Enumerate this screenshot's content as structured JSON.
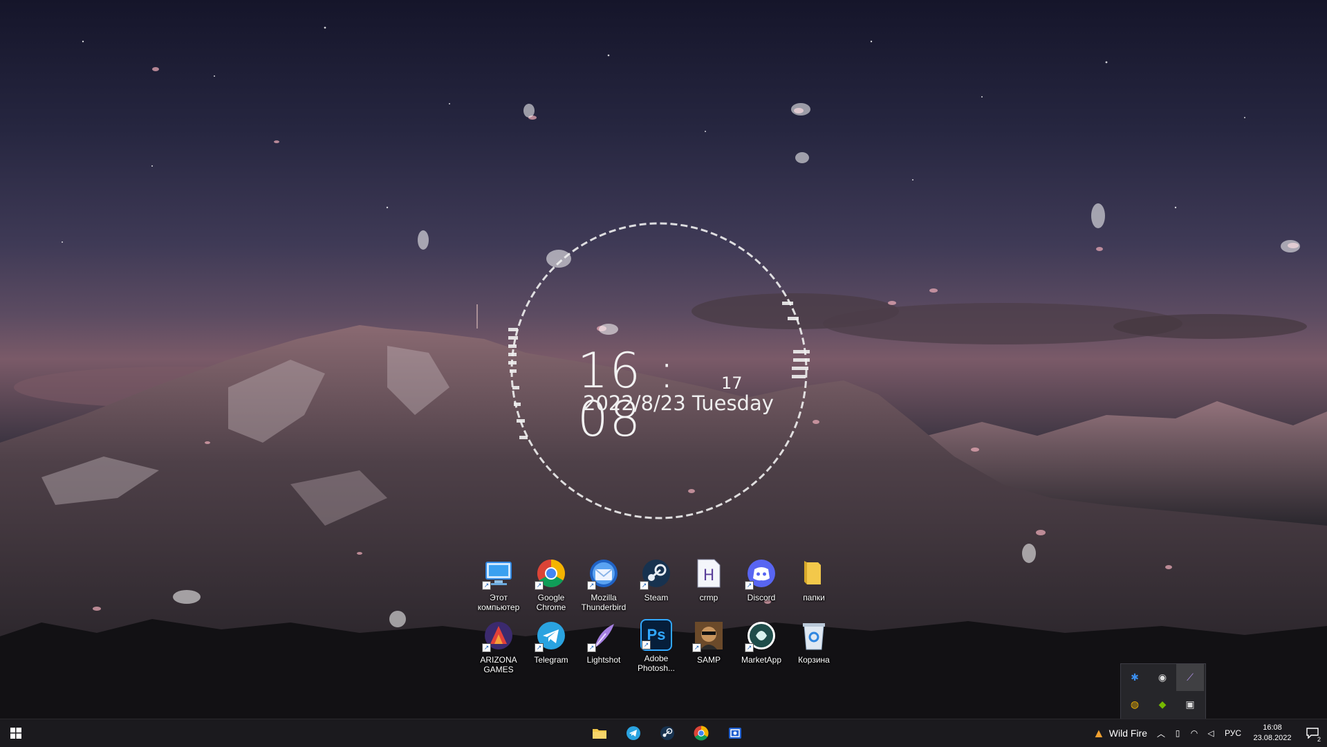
{
  "clock": {
    "time": "16 : 08",
    "seconds": "17",
    "date": "2022/8/23 Tuesday"
  },
  "desktop_icons": {
    "row1": [
      {
        "label": "Этот компьютер",
        "icon": "computer-icon"
      },
      {
        "label": "Google Chrome",
        "icon": "chrome-icon"
      },
      {
        "label": "Mozilla Thunderbird",
        "icon": "thunderbird-icon"
      },
      {
        "label": "Steam",
        "icon": "steam-icon"
      },
      {
        "label": "crmp",
        "icon": "crmp-icon"
      },
      {
        "label": "Discord",
        "icon": "discord-icon"
      },
      {
        "label": "папки",
        "icon": "folder-icon"
      }
    ],
    "row2": [
      {
        "label": "ARIZONA GAMES",
        "icon": "arizona-games-icon"
      },
      {
        "label": "Telegram",
        "icon": "telegram-icon"
      },
      {
        "label": "Lightshot",
        "icon": "lightshot-icon"
      },
      {
        "label": "Adobe Photosh...",
        "icon": "photoshop-icon"
      },
      {
        "label": "SAMP",
        "icon": "samp-icon"
      },
      {
        "label": "MarketApp",
        "icon": "marketapp-icon"
      },
      {
        "label": "Корзина",
        "icon": "recycle-bin-icon"
      }
    ]
  },
  "photoshop_glyph": "Ps",
  "crmp_glyph": "H",
  "tray_overflow": [
    "bluetooth-icon",
    "steam-icon",
    "lightshot-icon",
    "chrome-icon",
    "nvidia-icon",
    "gpu-icon"
  ],
  "taskbar": {
    "pins": [
      "file-explorer-icon",
      "telegram-icon",
      "steam-icon",
      "chrome-icon",
      "screen-capture-icon"
    ],
    "weather_label": "Wild Fire",
    "language": "РУС",
    "time": "16:08",
    "date": "23.08.2022",
    "notification_count": "2"
  },
  "colors": {
    "taskbar": "#1b1a1e",
    "accent": "#2f86e0",
    "sky_top": "#15152a",
    "sky_glow": "#7a5a68"
  }
}
